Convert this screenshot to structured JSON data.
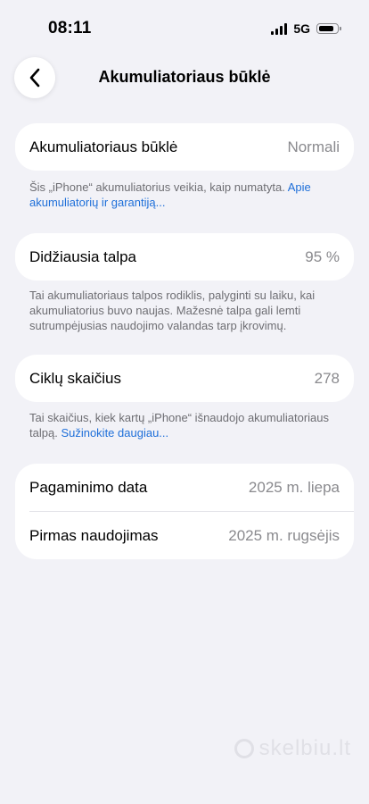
{
  "status_bar": {
    "time": "08:11",
    "network": "5G",
    "signal_bars": 4,
    "battery_level": 0.85
  },
  "nav": {
    "title": "Akumuliatoriaus būklė",
    "back_icon": "chevron-left-icon"
  },
  "health": {
    "label": "Akumuliatoriaus būklė",
    "value": "Normali",
    "note": "Šis „iPhone“ akumuliatorius veikia, kaip numatyta.",
    "link": "Apie akumuliatorių ir garantiją..."
  },
  "capacity": {
    "label": "Didžiausia talpa",
    "value": "95 %",
    "note": "Tai akumuliatoriaus talpos rodiklis, palyginti su laiku, kai akumuliatorius buvo naujas. Mažesnė talpa gali lemti sutrumpėjusias naudojimo valandas tarp įkrovimų."
  },
  "cycles": {
    "label": "Ciklų skaičius",
    "value": "278",
    "note": "Tai skaičius, kiek kartų „iPhone“ išnaudojo akumuliatoriaus talpą.",
    "link": "Sužinokite daugiau..."
  },
  "dates": {
    "manufactured_label": "Pagaminimo data",
    "manufactured_value": "2025 m. liepa",
    "first_use_label": "Pirmas naudojimas",
    "first_use_value": "2025 m. rugsėjis"
  },
  "watermark": {
    "text": "skelbiu.lt"
  },
  "colors": {
    "background": "#f2f2f7",
    "card": "#ffffff",
    "secondary_text": "#8a8a8e",
    "link": "#1e6fd9"
  }
}
